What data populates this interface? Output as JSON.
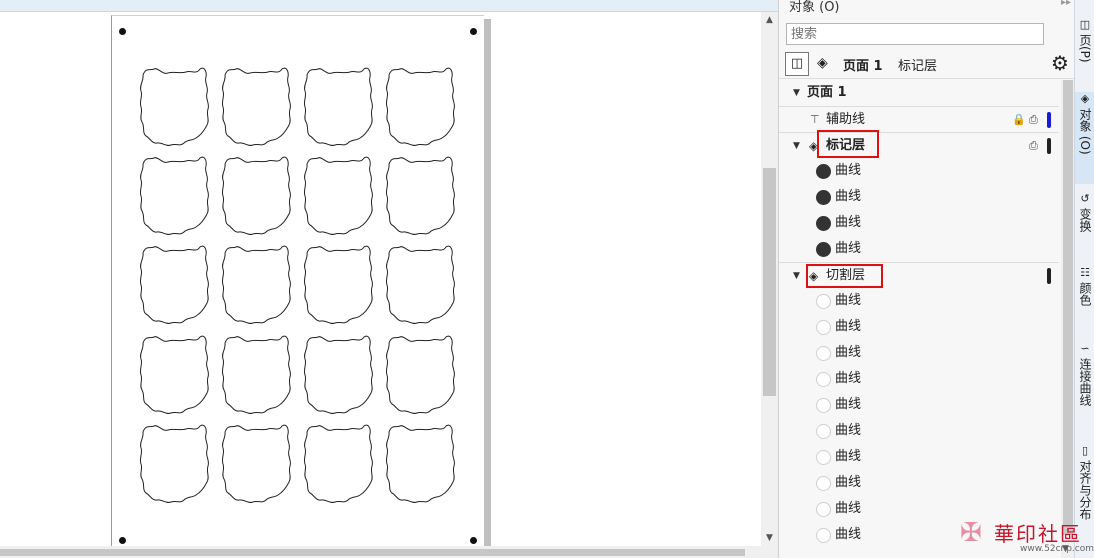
{
  "canvas": {
    "shape_count": 20,
    "scroll_up_glyph": "▲",
    "scroll_down_glyph": "▼"
  },
  "docker": {
    "title": "对象 (O)",
    "pin_glyph": "▸▸",
    "close_glyph": "✕",
    "search_placeholder": "搜索",
    "breadcrumb": {
      "page": "页面 1",
      "layer": "标记层"
    },
    "tree": {
      "page_node": "页面 1",
      "guides_layer": "辅助线",
      "mark_layer": {
        "label": "标记层",
        "items": [
          "曲线",
          "曲线",
          "曲线",
          "曲线"
        ]
      },
      "cut_layer": {
        "label": "切割层",
        "items": [
          "曲线",
          "曲线",
          "曲线",
          "曲线",
          "曲线",
          "曲线",
          "曲线",
          "曲线",
          "曲线",
          "曲线"
        ]
      }
    },
    "colors": {
      "guides_chip": "#1a1ad6",
      "mark_chip": "#222222",
      "cut_chip": "#222222",
      "highlight_box": "#dd1111"
    }
  },
  "side_tabs": [
    {
      "label": "页(P)",
      "icon": "page-icon"
    },
    {
      "label": "对象 (O)",
      "icon": "layers-icon"
    },
    {
      "label": "变换",
      "icon": "transform-icon"
    },
    {
      "label": "颜色",
      "icon": "color-icon"
    },
    {
      "label": "连接曲线",
      "icon": "connect-curve-icon"
    },
    {
      "label": "对齐与分布",
      "icon": "align-icon"
    }
  ],
  "watermark": {
    "text": "華印社區",
    "url": "www.52cnp.com"
  }
}
